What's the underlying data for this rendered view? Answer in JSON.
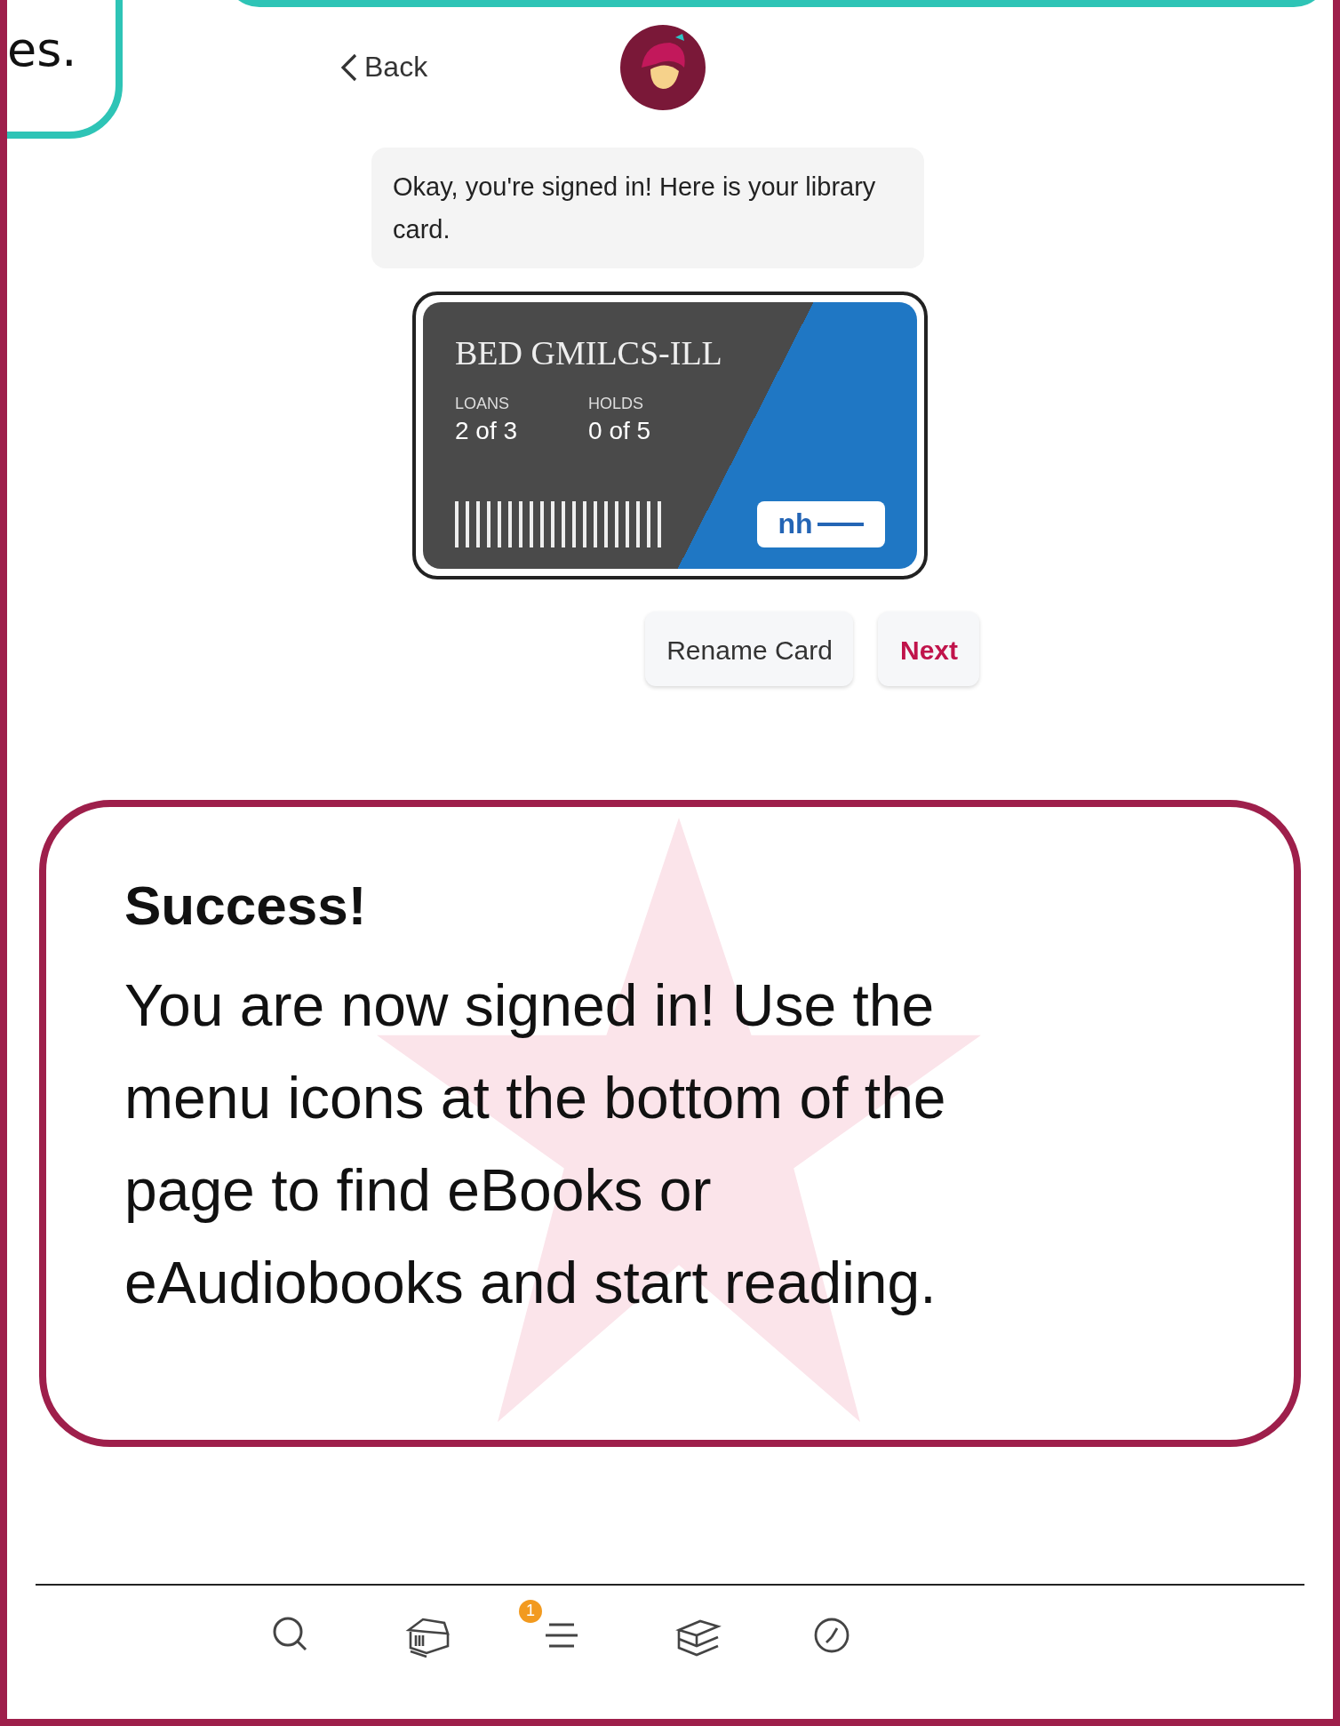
{
  "top_callout": {
    "text": "es."
  },
  "header": {
    "back": "Back"
  },
  "message": "Okay, you're signed in! Here is your library card.",
  "card": {
    "name": "BED GMILCS-ILL",
    "stats": [
      {
        "label": "LOANS",
        "value": "2 of 3"
      },
      {
        "label": "HOLDS",
        "value": "0 of 5"
      }
    ],
    "logo_text": "nh"
  },
  "buttons": [
    {
      "label": "Rename Card",
      "kind": "plain"
    },
    {
      "label": "Next",
      "kind": "primary"
    }
  ],
  "tip": {
    "title": "Success!",
    "body": "You are now signed in! Use the menu icons at the bottom of the page to find eBooks or eAudiobooks and start reading."
  },
  "nav": [
    {
      "kind": "search"
    },
    {
      "kind": "library"
    },
    {
      "kind": "menu",
      "badge": "1"
    },
    {
      "kind": "shelf"
    },
    {
      "kind": "activity"
    }
  ]
}
